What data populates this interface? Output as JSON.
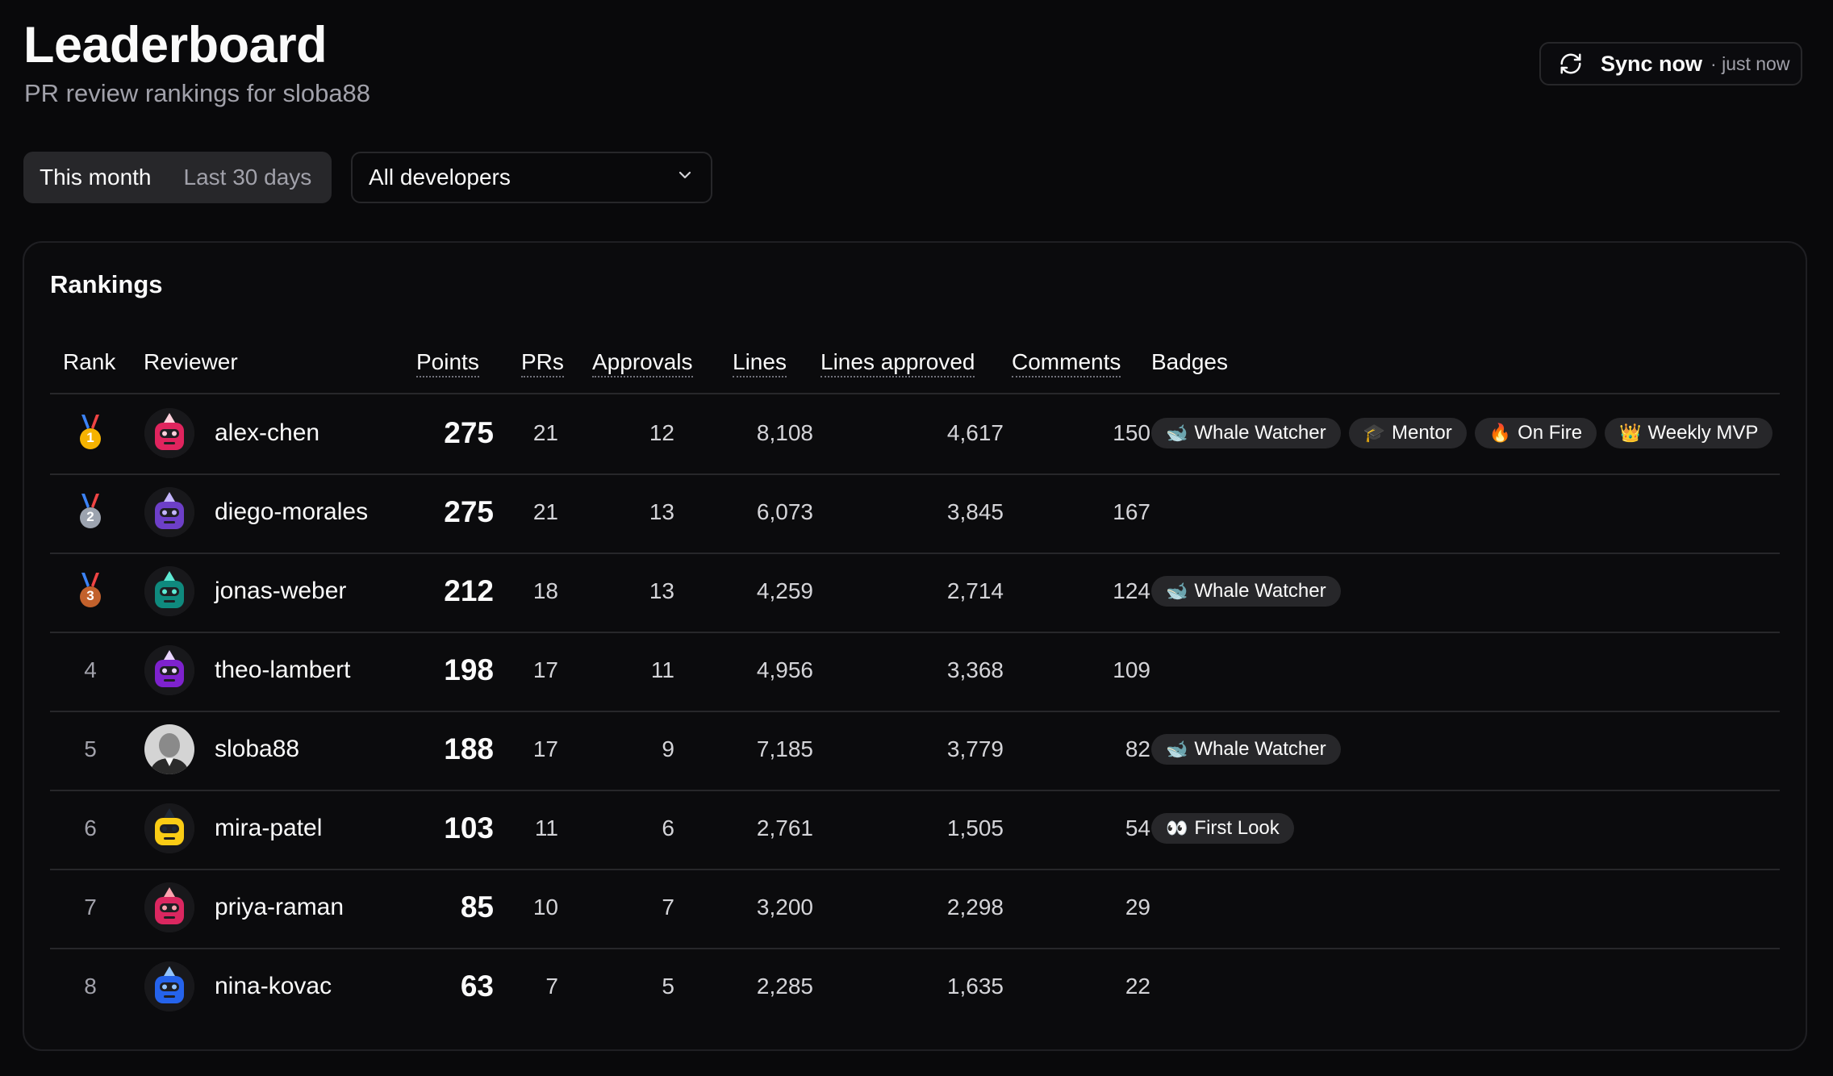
{
  "header": {
    "title": "Leaderboard",
    "subtitle": "PR review rankings for sloba88",
    "sync_label": "Sync now",
    "sync_time": "· just now"
  },
  "filters": {
    "period_options": [
      "This month",
      "Last 30 days"
    ],
    "selected_period": "This month",
    "developer_select": "All developers"
  },
  "rankings": {
    "title": "Rankings",
    "columns": {
      "rank": "Rank",
      "reviewer": "Reviewer",
      "points": "Points",
      "prs": "PRs",
      "approvals": "Approvals",
      "lines": "Lines",
      "lines_approved": "Lines approved",
      "comments": "Comments",
      "badges": "Badges"
    },
    "rows": [
      {
        "rank": "1",
        "medal": "gold",
        "avatar": "pink-robot",
        "name": "alex-chen",
        "points": "275",
        "prs": "21",
        "approvals": "12",
        "lines": "8,108",
        "lines_approved": "4,617",
        "comments": "150",
        "badges": [
          {
            "icon": "whale",
            "label": "Whale Watcher"
          },
          {
            "icon": "graduation-cap",
            "label": "Mentor"
          },
          {
            "icon": "fire",
            "label": "On Fire"
          },
          {
            "icon": "crown",
            "label": "Weekly MVP"
          }
        ]
      },
      {
        "rank": "2",
        "medal": "silver",
        "avatar": "purple-robot",
        "name": "diego-morales",
        "points": "275",
        "prs": "21",
        "approvals": "13",
        "lines": "6,073",
        "lines_approved": "3,845",
        "comments": "167",
        "badges": []
      },
      {
        "rank": "3",
        "medal": "bronze",
        "avatar": "teal-robot",
        "name": "jonas-weber",
        "points": "212",
        "prs": "18",
        "approvals": "13",
        "lines": "4,259",
        "lines_approved": "2,714",
        "comments": "124",
        "badges": [
          {
            "icon": "whale",
            "label": "Whale Watcher"
          }
        ]
      },
      {
        "rank": "4",
        "medal": "",
        "avatar": "violet-robot",
        "name": "theo-lambert",
        "points": "198",
        "prs": "17",
        "approvals": "11",
        "lines": "4,956",
        "lines_approved": "3,368",
        "comments": "109",
        "badges": []
      },
      {
        "rank": "5",
        "medal": "",
        "avatar": "photo",
        "name": "sloba88",
        "points": "188",
        "prs": "17",
        "approvals": "9",
        "lines": "7,185",
        "lines_approved": "3,779",
        "comments": "82",
        "badges": [
          {
            "icon": "whale",
            "label": "Whale Watcher"
          }
        ]
      },
      {
        "rank": "6",
        "medal": "",
        "avatar": "yellow-robot",
        "name": "mira-patel",
        "points": "103",
        "prs": "11",
        "approvals": "6",
        "lines": "2,761",
        "lines_approved": "1,505",
        "comments": "54",
        "badges": [
          {
            "icon": "eyes",
            "label": "First Look"
          }
        ]
      },
      {
        "rank": "7",
        "medal": "",
        "avatar": "red-robot",
        "name": "priya-raman",
        "points": "85",
        "prs": "10",
        "approvals": "7",
        "lines": "3,200",
        "lines_approved": "2,298",
        "comments": "29",
        "badges": []
      },
      {
        "rank": "8",
        "medal": "",
        "avatar": "blue-robot",
        "name": "nina-kovac",
        "points": "63",
        "prs": "7",
        "approvals": "5",
        "lines": "2,285",
        "lines_approved": "1,635",
        "comments": "22",
        "badges": []
      }
    ]
  },
  "colors": {
    "background": "#09090b",
    "card_border": "#1f1f23",
    "badge_bg": "#27272a",
    "muted_text": "#a1a1aa"
  }
}
